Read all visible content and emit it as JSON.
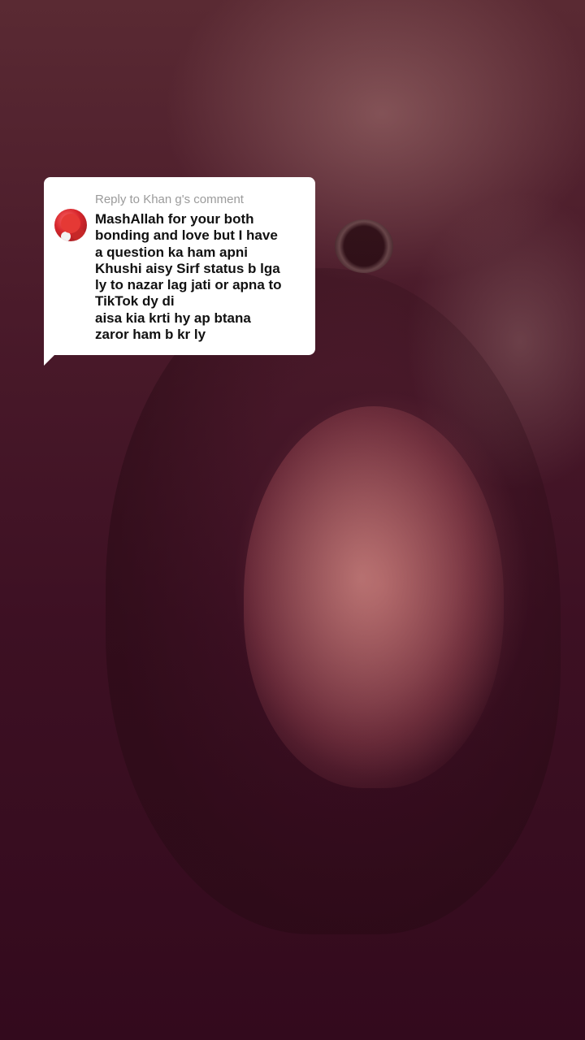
{
  "reply": {
    "header": "Reply to Khan g's comment",
    "avatar_icon": "profile-avatar",
    "comment": "MashAllah for your both\nbonding and love but I have\na question ka ham apni\nKhushi aisy Sirf status b lga\nly to nazar lag jati or apna to\nTikTok dy di\naisa kia krti hy ap btana\nzaror ham b kr ly"
  },
  "colors": {
    "card_background": "#ffffff",
    "header_text": "#9b9b9b",
    "comment_text": "#111111",
    "scene_tint": "#3d1023"
  }
}
